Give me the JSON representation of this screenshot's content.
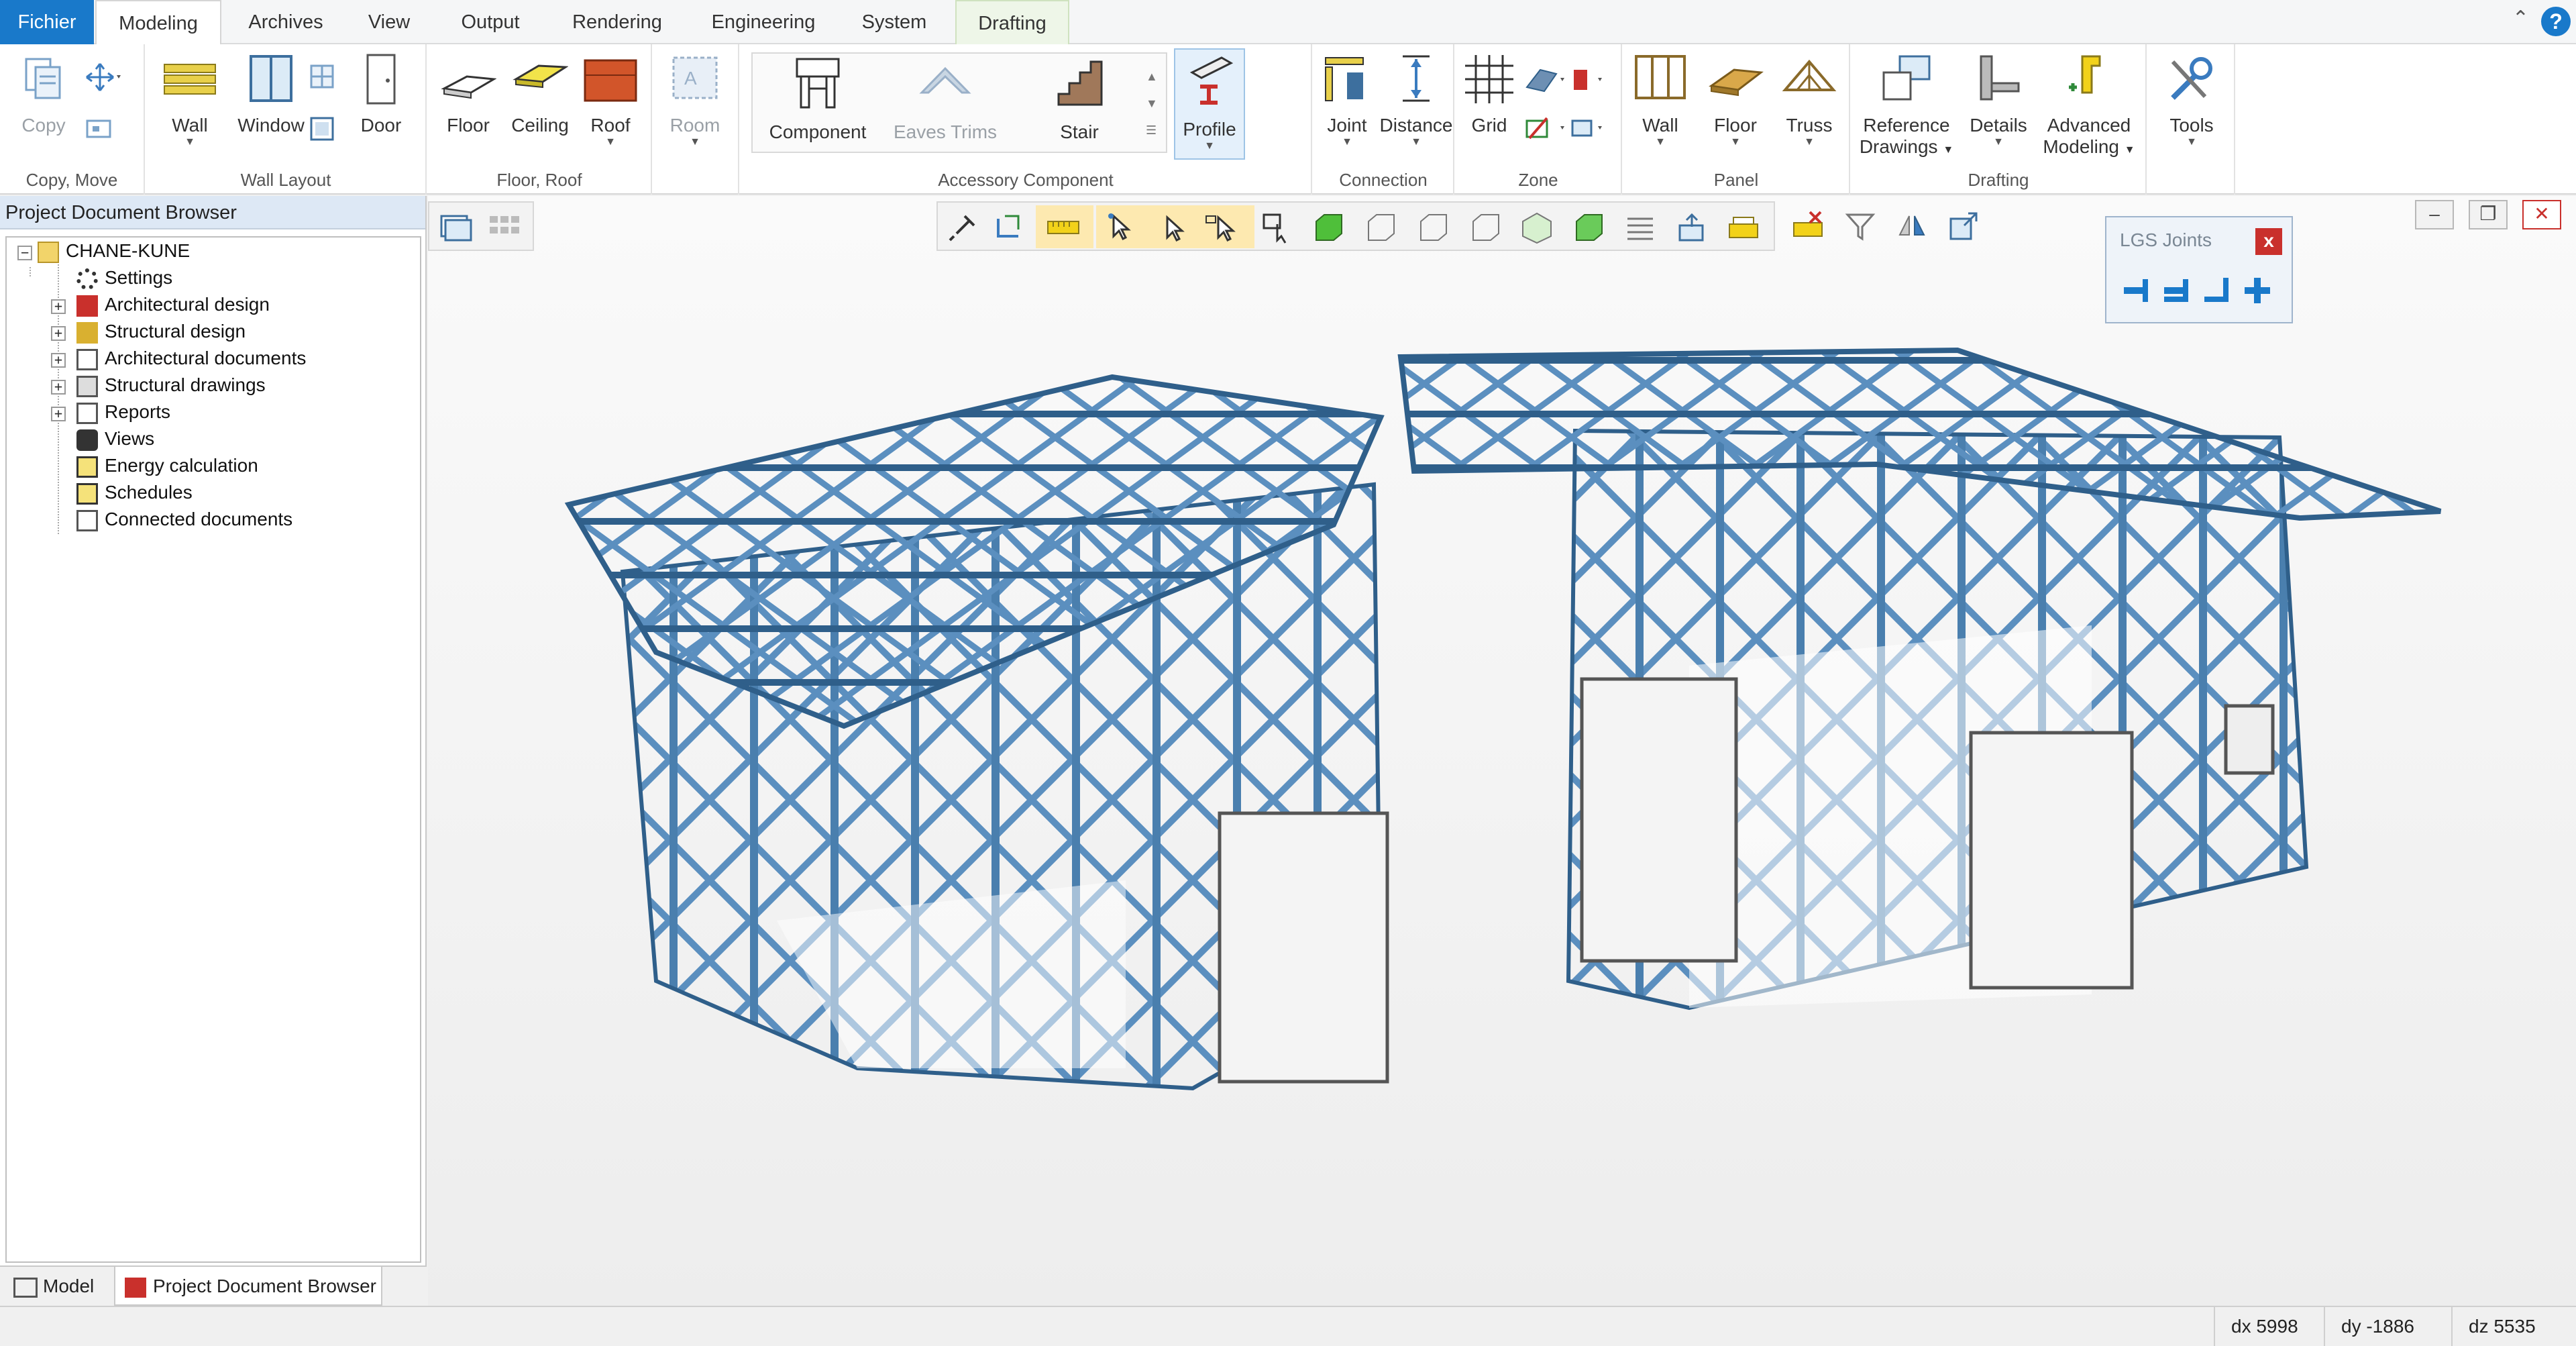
{
  "tabs": [
    {
      "label": "Fichier"
    },
    {
      "label": "Modeling"
    },
    {
      "label": "Archives"
    },
    {
      "label": "View"
    },
    {
      "label": "Output"
    },
    {
      "label": "Rendering"
    },
    {
      "label": "Engineering"
    },
    {
      "label": "System"
    },
    {
      "label": "Drafting"
    }
  ],
  "ribbon": {
    "copy_move": {
      "copy": "Copy",
      "group": "Copy, Move"
    },
    "wall_layout": {
      "wall": "Wall",
      "window": "Window",
      "door": "Door",
      "group": "Wall Layout"
    },
    "floor_roof": {
      "floor": "Floor",
      "ceiling": "Ceiling",
      "roof": "Roof",
      "group": "Floor, Roof"
    },
    "room": {
      "label": "Room"
    },
    "accessory": {
      "component": "Component",
      "eaves": "Eaves Trims",
      "stair": "Stair",
      "profile": "Profile",
      "group": "Accessory Component"
    },
    "connection": {
      "joint": "Joint",
      "distance": "Distance",
      "group": "Connection"
    },
    "zone": {
      "grid": "Grid",
      "group": "Zone"
    },
    "panel": {
      "wall": "Wall",
      "floor": "Floor",
      "truss": "Truss",
      "group": "Panel"
    },
    "drafting": {
      "ref1": "Reference",
      "ref2": "Drawings",
      "details": "Details",
      "adv1": "Advanced",
      "adv2": "Modeling",
      "group": "Drafting"
    },
    "tools": {
      "label": "Tools"
    }
  },
  "browser": {
    "title": "Project Document Browser",
    "root": "CHANE-KUNE",
    "items": [
      {
        "label": "Settings"
      },
      {
        "label": "Architectural design"
      },
      {
        "label": "Structural design"
      },
      {
        "label": "Architectural documents"
      },
      {
        "label": "Structural drawings"
      },
      {
        "label": "Reports"
      },
      {
        "label": "Views"
      },
      {
        "label": "Energy calculation"
      },
      {
        "label": "Schedules"
      },
      {
        "label": "Connected documents"
      }
    ],
    "bottom_tabs": {
      "model": "Model",
      "browser": "Project Document Browser"
    }
  },
  "lgs": {
    "title": "LGS Joints",
    "close": "x"
  },
  "status": {
    "dx": "dx 5998",
    "dy": "dy -1886",
    "dz": "dz 5535"
  },
  "colors": {
    "accent": "#1979ca",
    "steel": "#5b8fbf",
    "steel_dark": "#2f5f8a"
  }
}
